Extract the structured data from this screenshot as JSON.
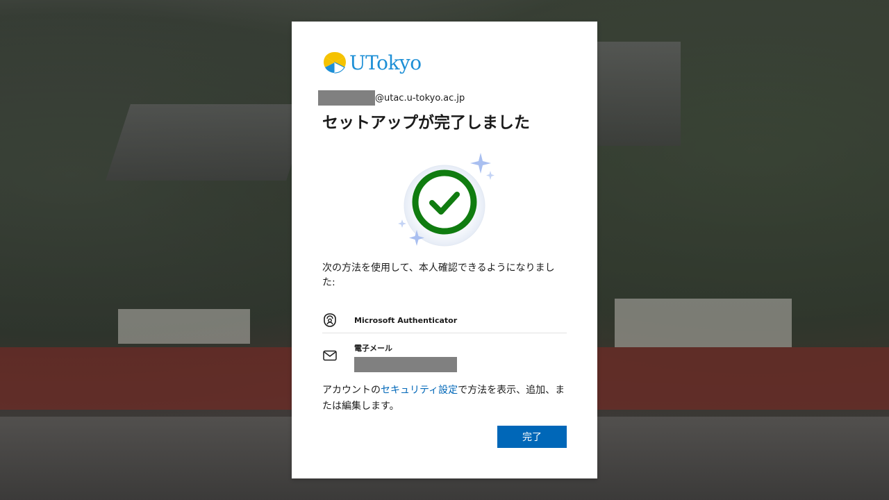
{
  "brand": {
    "name": "UTokyo",
    "logo_icon": "ginkgo-leaf-logo",
    "colors": {
      "text": "#1d8fd6",
      "leaf_yellow": "#f5c200",
      "leaf_blue": "#1d8fd6"
    }
  },
  "account": {
    "domain_suffix": "@utac.u-tokyo.ac.jp"
  },
  "page": {
    "title": "セットアップが完了しました",
    "description": "次の方法を使用して、本人確認できるようになりました:",
    "success_icon": "check-circle-icon",
    "success_color": "#107c10"
  },
  "methods": [
    {
      "icon": "authenticator-lock-icon",
      "name": "Microsoft Authenticator"
    },
    {
      "icon": "mail-envelope-icon",
      "name": "電子メール"
    }
  ],
  "footer": {
    "prefix": "アカウントの",
    "link_text": "セキュリティ設定",
    "suffix": "で方法を表示、追加、または編集します。"
  },
  "actions": {
    "done_label": "完了",
    "primary_color": "#0067b8"
  }
}
